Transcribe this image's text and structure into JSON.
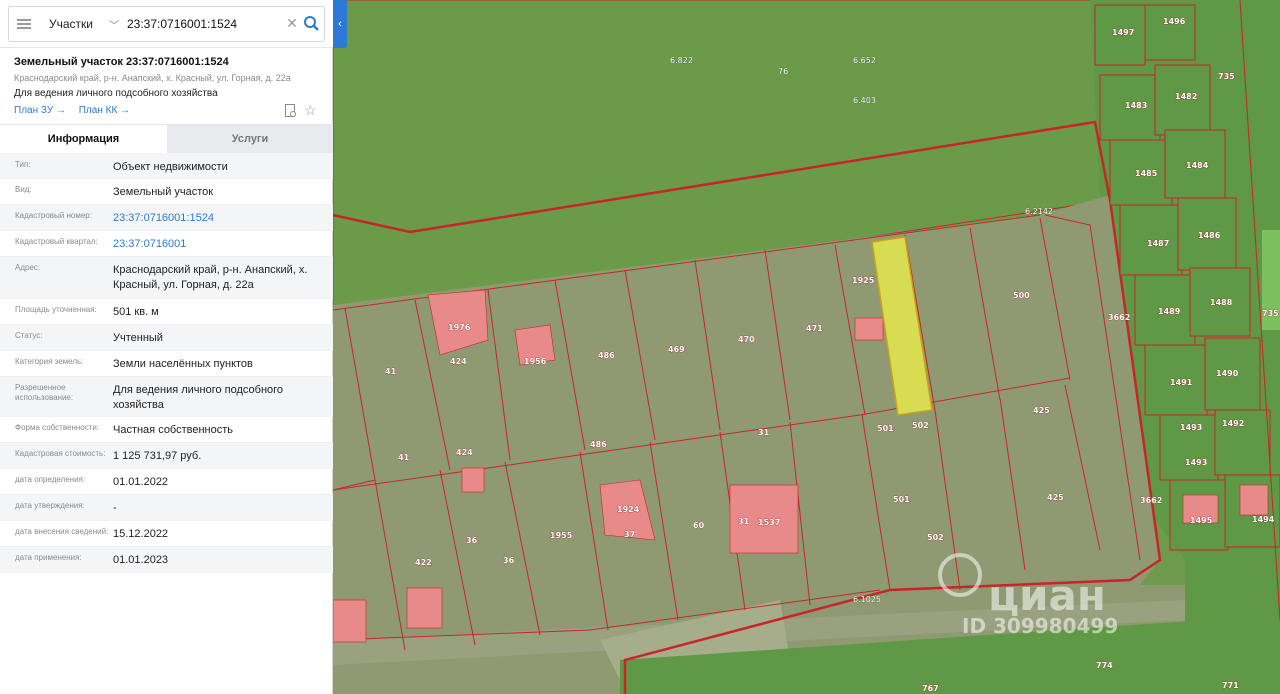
{
  "search": {
    "type_label": "Участки",
    "query": "23:37:0716001:1524"
  },
  "object": {
    "title": "Земельный участок 23:37:0716001:1524",
    "address": "Краснодарский край, р-н. Анапский, х. Красный, ул. Горная, д. 22а",
    "use": "Для ведения личного подсобного хозяйства",
    "link_plan_zu": "План ЗУ →",
    "link_plan_kk": "План КК →"
  },
  "tabs": {
    "info": "Информация",
    "services": "Услуги"
  },
  "info_rows": [
    {
      "label": "Тип:",
      "value": "Объект недвижимости"
    },
    {
      "label": "Вид:",
      "value": "Земельный участок"
    },
    {
      "label": "Кадастровый номер:",
      "value": "23:37:0716001:1524"
    },
    {
      "label": "Кадастровый квартал:",
      "value": "23:37:0716001"
    },
    {
      "label": "Адрес:",
      "value": "Краснодарский край, р-н. Анапский, х. Красный, ул. Горная, д. 22а"
    },
    {
      "label": "Площадь уточненная:",
      "value": "501 кв. м"
    },
    {
      "label": "Статус:",
      "value": "Учтенный"
    },
    {
      "label": "Категория земель:",
      "value": "Земли населённых пунктов"
    },
    {
      "label": "Разрешенное использование:",
      "value": "Для ведения личного подсобного хозяйства"
    },
    {
      "label": "Форма собственности:",
      "value": "Частная собственность"
    },
    {
      "label": "Кадастровая стоимость:",
      "value": "1 125 731,97 руб."
    },
    {
      "label": "дата определения:",
      "value": "01.01.2022"
    },
    {
      "label": "дата утверждения:",
      "value": "-"
    },
    {
      "label": "дата внесения сведений:",
      "value": "15.12.2022"
    },
    {
      "label": "дата применения:",
      "value": "01.01.2023"
    }
  ],
  "map_labels": {
    "top": [
      "6.822",
      "76",
      "6.652",
      "6.403",
      "6.2142"
    ],
    "right_column": [
      "1497",
      "1496",
      "1483",
      "1482",
      "735",
      "1485",
      "1484",
      "1487",
      "1486",
      "1489",
      "1488",
      "735",
      "1491",
      "1490",
      "1493",
      "1492",
      "1495",
      "1494",
      "3662"
    ],
    "parcels": [
      "41",
      "424",
      "486",
      "469",
      "470",
      "471",
      "500",
      "1956",
      "1976",
      "424",
      "486",
      "31",
      "501",
      "502",
      "425",
      "41",
      "422",
      "36",
      "1955",
      "37",
      "60",
      "1537",
      "501",
      "502",
      "425",
      "3662",
      "6.1025",
      "1924",
      "1925",
      "774",
      "767",
      "771"
    ]
  },
  "watermark": {
    "brand": "циан",
    "id_text": "ID 309980499"
  },
  "colors": {
    "map_green": "#6e9a4c",
    "parcel_fill": "#8f9a72",
    "boundary": "#c8252b",
    "building": "#e88a8a",
    "selected": "#d8dc52",
    "accent": "#2c7ad6"
  }
}
